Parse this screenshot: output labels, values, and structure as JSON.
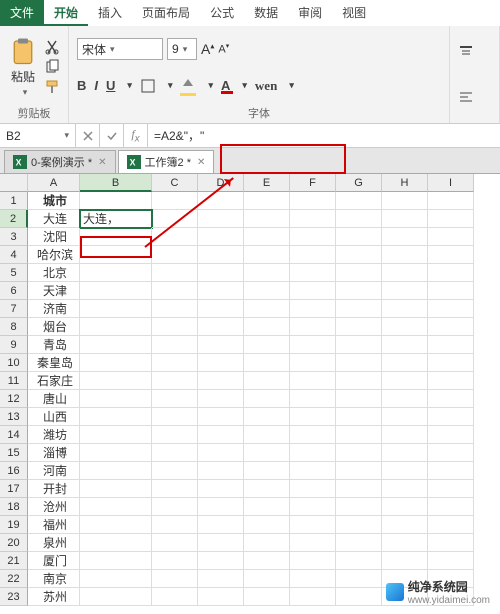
{
  "ribbon_tabs": [
    "文件",
    "开始",
    "插入",
    "页面布局",
    "公式",
    "数据",
    "审阅",
    "视图"
  ],
  "active_ribbon_tab": 1,
  "clipboard": {
    "paste_label": "粘贴",
    "group_label": "剪贴板"
  },
  "font_group": {
    "font_name": "宋体",
    "font_size": "9",
    "group_label": "字体",
    "buttons": {
      "bold": "B",
      "italic": "I",
      "underline": "U",
      "wen": "wen"
    }
  },
  "name_box": "B2",
  "formula": "=A2&\"，\"",
  "workbooks": [
    {
      "label": "0-案例演示 *",
      "active": false
    },
    {
      "label": "工作簿2 *",
      "active": true
    }
  ],
  "columns": [
    "A",
    "B",
    "C",
    "D",
    "E",
    "F",
    "G",
    "H",
    "I"
  ],
  "selected_col": 1,
  "selected_row": 2,
  "cells": {
    "A1": "城市",
    "A2": "大连",
    "B2": "大连，",
    "A3": "沈阳",
    "A4": "哈尔滨",
    "A5": "北京",
    "A6": "天津",
    "A7": "济南",
    "A8": "烟台",
    "A9": "青岛",
    "A10": "秦皇岛",
    "A11": "石家庄",
    "A12": "唐山",
    "A13": "山西",
    "A14": "潍坊",
    "A15": "淄博",
    "A16": "河南",
    "A17": "开封",
    "A18": "沧州",
    "A19": "福州",
    "A20": "泉州",
    "A21": "厦门",
    "A22": "南京",
    "A23": "苏州"
  },
  "row_count": 23,
  "watermark": {
    "title": "纯净系统园",
    "url": "www.yidaimei.com"
  }
}
